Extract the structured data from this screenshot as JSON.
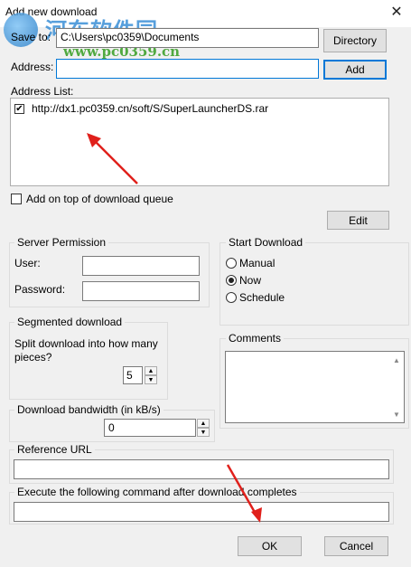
{
  "window": {
    "title": "Add new download",
    "close_glyph": "✕"
  },
  "watermark": {
    "line1": "河东软件园",
    "line2": "www.pc0359.cn"
  },
  "save_to": {
    "label": "Save to:",
    "value": "C:\\Users\\pc0359\\Documents",
    "button": "Directory"
  },
  "address": {
    "label": "Address:",
    "value": "",
    "button": "Add"
  },
  "address_list": {
    "label": "Address List:",
    "items": [
      {
        "checked": true,
        "url": "http://dx1.pc0359.cn/soft/S/SuperLauncherDS.rar"
      }
    ]
  },
  "add_on_top": {
    "label": "Add on top of download queue",
    "checked": false
  },
  "edit_button": "Edit",
  "server_permission": {
    "title": "Server Permission",
    "user_label": "User:",
    "user_value": "",
    "password_label": "Password:",
    "password_value": ""
  },
  "start_download": {
    "title": "Start Download",
    "options": [
      {
        "label": "Manual",
        "selected": false
      },
      {
        "label": "Now",
        "selected": true
      },
      {
        "label": "Schedule",
        "selected": false
      }
    ]
  },
  "segmented": {
    "title": "Segmented download",
    "prompt": "Split download into how many pieces?",
    "value": "5"
  },
  "comments": {
    "title": "Comments",
    "value": ""
  },
  "bandwidth": {
    "title": "Download bandwidth (in kB/s)",
    "value": "0"
  },
  "reference": {
    "title": "Reference URL",
    "value": ""
  },
  "execute": {
    "title": "Execute the following command after download completes",
    "value": ""
  },
  "footer": {
    "ok": "OK",
    "cancel": "Cancel"
  },
  "colors": {
    "accent": "#0078d7",
    "arrow": "#e0201b"
  }
}
